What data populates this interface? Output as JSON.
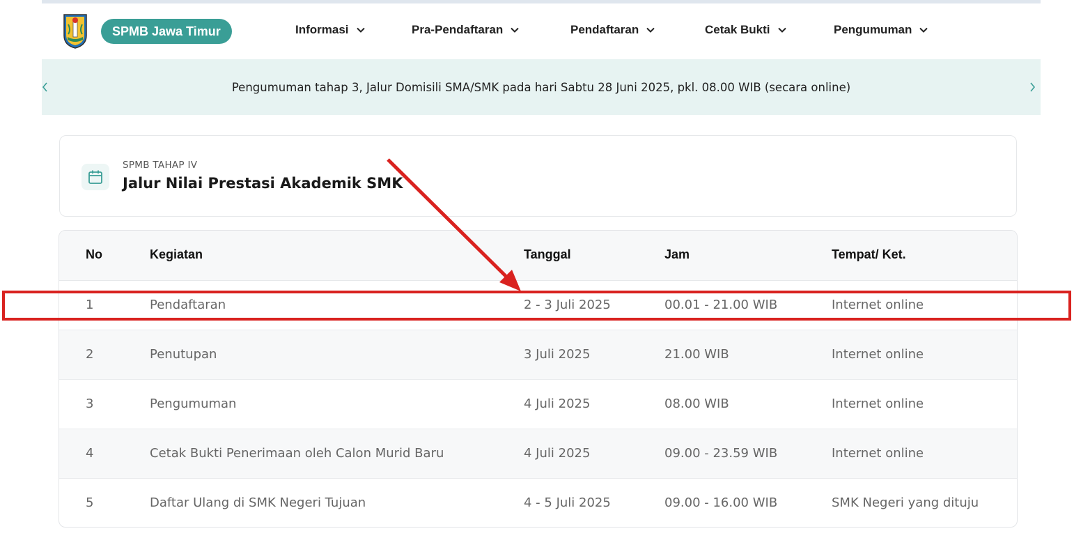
{
  "header": {
    "logo_icon": "jawa-timur-emblem-icon",
    "brand": "SPMB Jawa Timur",
    "nav": [
      {
        "label": "Informasi",
        "icon": "chevron-down-icon"
      },
      {
        "label": "Pra-Pendaftaran",
        "icon": "chevron-down-icon"
      },
      {
        "label": "Pendaftaran",
        "icon": "chevron-down-icon"
      },
      {
        "label": "Cetak Bukti",
        "icon": "chevron-down-icon"
      },
      {
        "label": "Pengumuman",
        "icon": "chevron-down-icon"
      }
    ]
  },
  "announcement": {
    "text": "Pengumuman tahap 3, Jalur Domisili SMA/SMK pada hari Sabtu 28 Juni 2025, pkl. 08.00 WIB (secara online)",
    "prev_icon": "chevron-left-icon",
    "next_icon": "chevron-right-icon"
  },
  "schedule": {
    "icon": "calendar-icon",
    "stage": "SPMB TAHAP IV",
    "route": "Jalur Nilai Prestasi Akademik SMK"
  },
  "table": {
    "headers": {
      "no": "No",
      "kegiatan": "Kegiatan",
      "tanggal": "Tanggal",
      "jam": "Jam",
      "tempat": "Tempat/ Ket."
    },
    "rows": [
      {
        "no": "1",
        "kegiatan": "Pendaftaran",
        "tanggal": "2 - 3 Juli 2025",
        "jam": "00.01 - 21.00 WIB",
        "tempat": "Internet online"
      },
      {
        "no": "2",
        "kegiatan": "Penutupan",
        "tanggal": "3 Juli 2025",
        "jam": "21.00 WIB",
        "tempat": "Internet online"
      },
      {
        "no": "3",
        "kegiatan": "Pengumuman",
        "tanggal": "4 Juli 2025",
        "jam": "08.00 WIB",
        "tempat": "Internet online"
      },
      {
        "no": "4",
        "kegiatan": "Cetak Bukti Penerimaan oleh Calon Murid Baru",
        "tanggal": "4 Juli 2025",
        "jam": "09.00 - 23.59 WIB",
        "tempat": "Internet online"
      },
      {
        "no": "5",
        "kegiatan": "Daftar Ulang di SMK Negeri Tujuan",
        "tanggal": "4 - 5 Juli 2025",
        "jam": "09.00 - 16.00 WIB",
        "tempat": "SMK Negeri yang dituju"
      }
    ]
  },
  "colors": {
    "brand": "#3a9e96",
    "announce_bg": "#e7f3f2",
    "annotation": "#d9221f"
  }
}
